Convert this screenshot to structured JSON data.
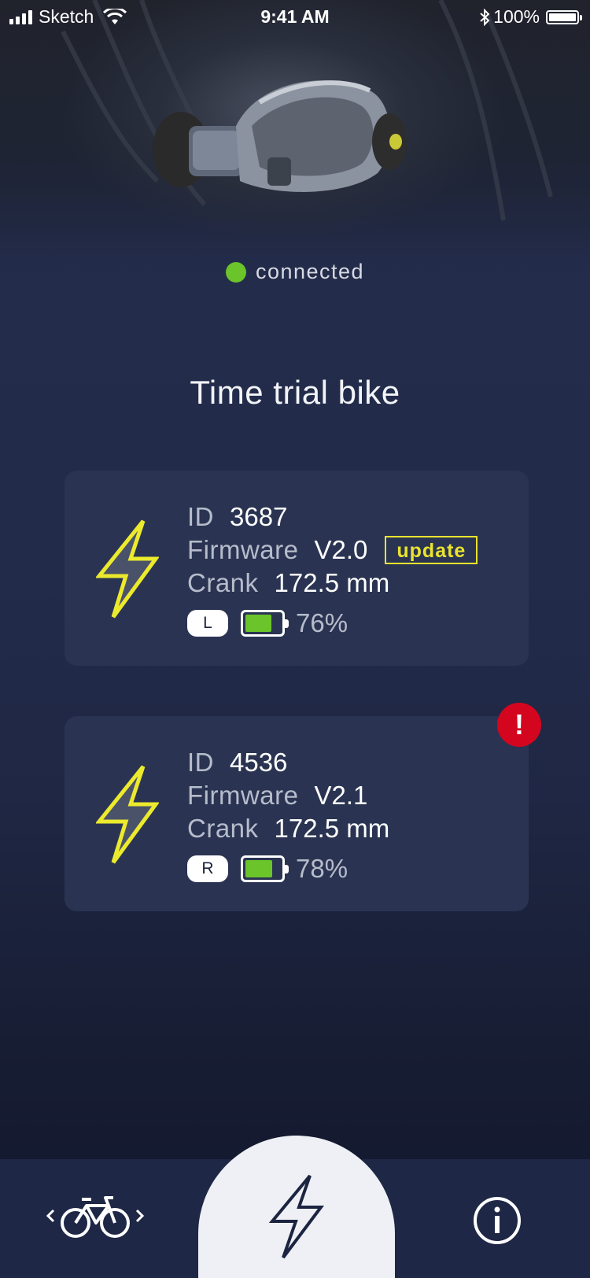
{
  "status_bar": {
    "carrier": "Sketch",
    "time": "9:41 AM",
    "battery": "100%"
  },
  "connection": {
    "status": "connected",
    "color": "#6ac42a"
  },
  "bike_name": "Time trial bike",
  "labels": {
    "id": "ID",
    "firmware": "Firmware",
    "crank": "Crank"
  },
  "sensors": [
    {
      "id": "3687",
      "firmware": "V2.0",
      "update_label": "update",
      "crank": "172.5 mm",
      "side": "L",
      "battery_pct": "76%",
      "battery_level": 0.76
    },
    {
      "id": "4536",
      "firmware": "V2.1",
      "crank": "172.5 mm",
      "side": "R",
      "battery_pct": "78%",
      "battery_level": 0.78,
      "alert": "!"
    }
  ],
  "tabs": [
    {
      "icon": "bike-switch-icon"
    },
    {
      "icon": "power-icon",
      "active": true
    },
    {
      "icon": "info-icon"
    }
  ],
  "colors": {
    "accent_yellow": "#e9e32e",
    "battery_green": "#6ac42a",
    "alert_red": "#d4061f",
    "card_bg": "#2a3452"
  }
}
